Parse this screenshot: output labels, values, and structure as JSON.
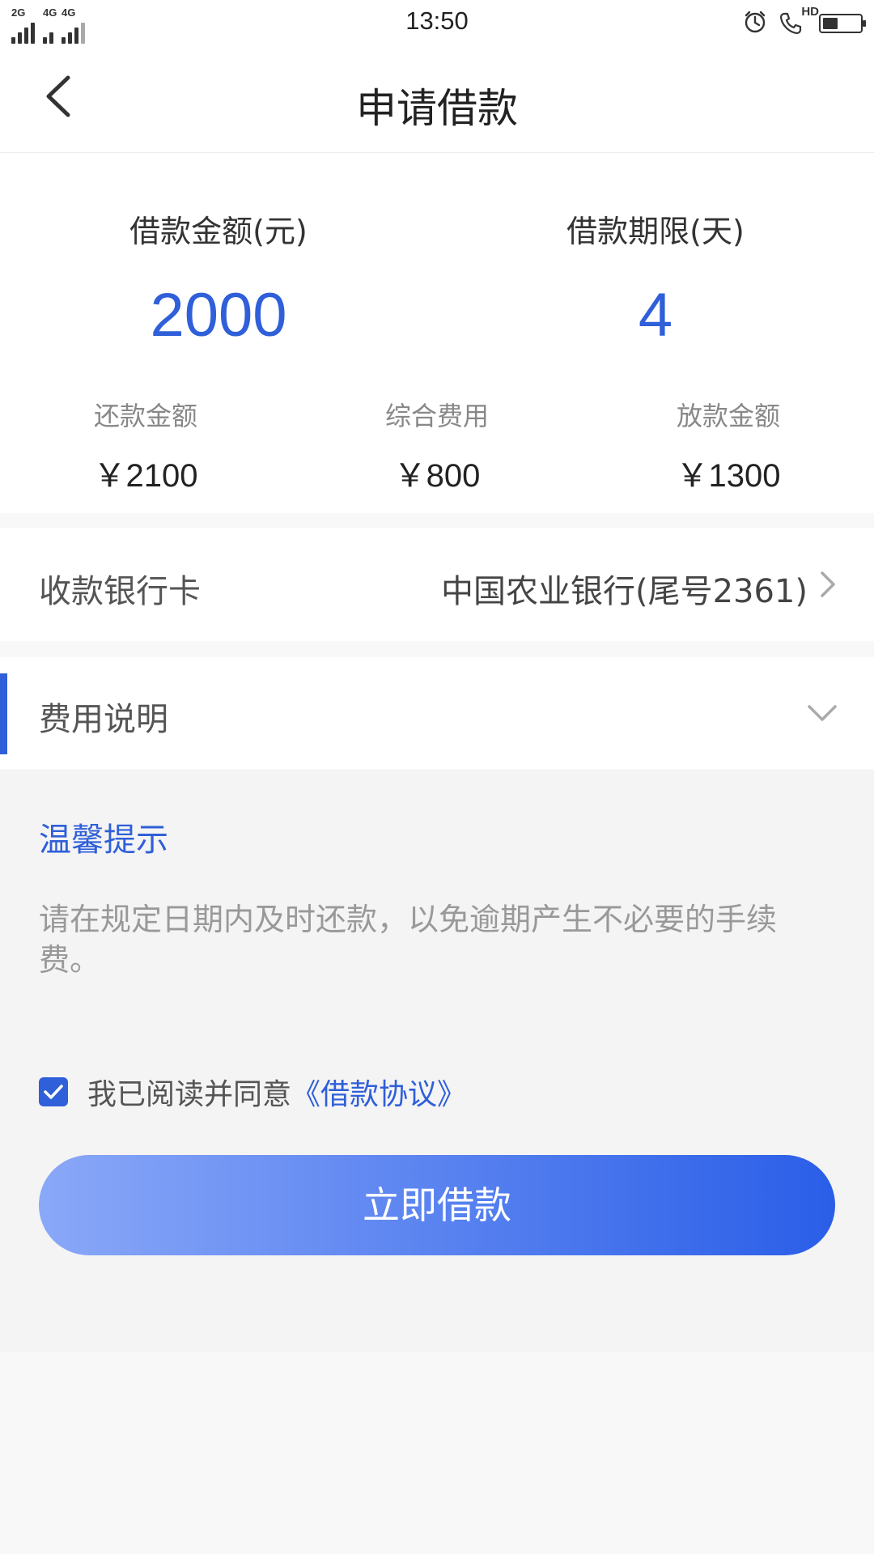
{
  "status_bar": {
    "network_left": "2G",
    "network_right": "4G",
    "network_right2": "4G",
    "time": "13:50",
    "hd": "HD",
    "battery_level": 0.4,
    "icons": [
      "alarm-icon",
      "hd-call-icon",
      "battery-icon"
    ]
  },
  "header": {
    "title": "申请借款",
    "back_icon": "chevron-left-icon"
  },
  "loan": {
    "amount_label": "借款金额(元)",
    "amount_value": "2000",
    "term_label": "借款期限(天)",
    "term_value": "4"
  },
  "fees": {
    "repay_label": "还款金额",
    "repay_value": "￥2100",
    "fee_label": "综合费用",
    "fee_value": "￥800",
    "disburse_label": "放款金额",
    "disburse_value": "￥1300"
  },
  "bank": {
    "label": "收款银行卡",
    "value": "中国农业银行(尾号2361)",
    "icon": "chevron-right-icon"
  },
  "fee_explain": {
    "label": "费用说明",
    "icon": "chevron-down-icon"
  },
  "tips": {
    "title": "温馨提示",
    "text": "请在规定日期内及时还款，以免逾期产生不必要的手续费。"
  },
  "agreement": {
    "checked": true,
    "text": "我已阅读并同意",
    "link": "《借款协议》"
  },
  "submit": {
    "label": "立即借款"
  },
  "colors": {
    "accent": "#2f5fd9",
    "gradient_start": "#8aa8f8",
    "gradient_end": "#2a5ee8"
  }
}
